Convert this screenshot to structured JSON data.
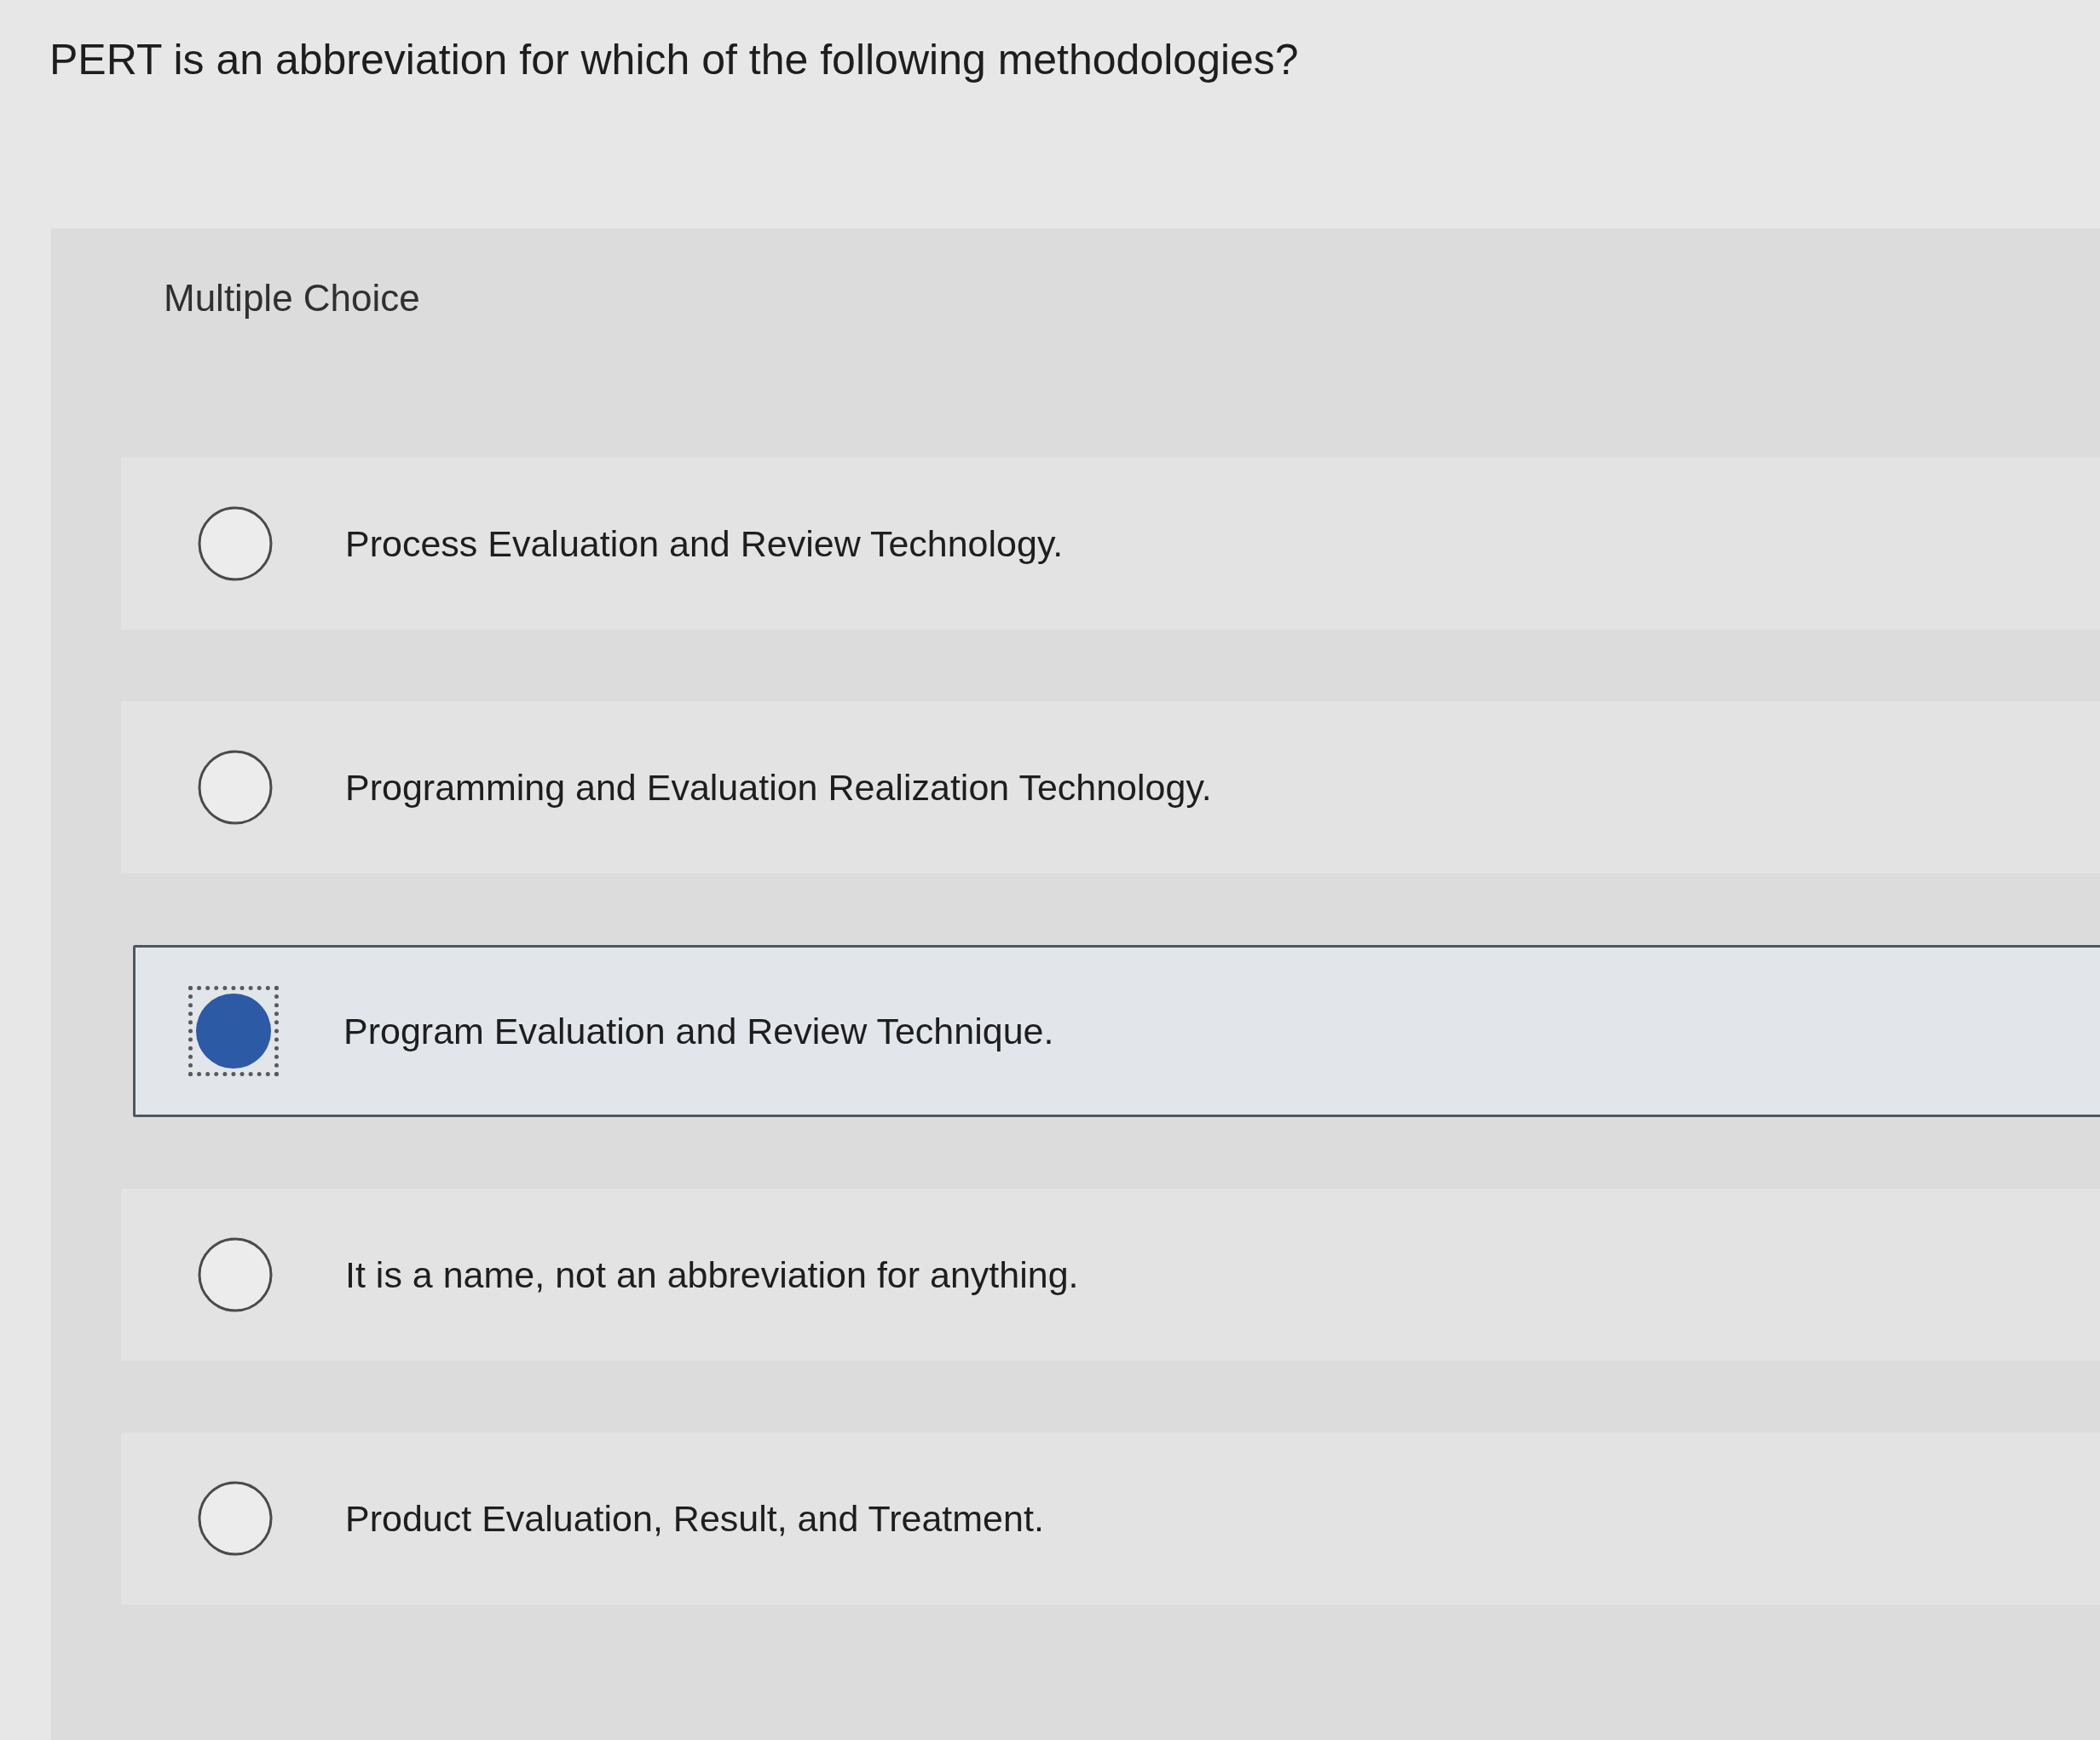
{
  "question": "PERT is an abbreviation for which of the following methodologies?",
  "panel": {
    "title": "Multiple Choice"
  },
  "options": [
    {
      "label": "Process Evaluation and Review Technology.",
      "selected": false
    },
    {
      "label": "Programming and Evaluation Realization Technology.",
      "selected": false
    },
    {
      "label": "Program Evaluation and Review Technique.",
      "selected": true
    },
    {
      "label": "It is a name, not an abbreviation for anything.",
      "selected": false
    },
    {
      "label": "Product Evaluation, Result, and Treatment.",
      "selected": false
    }
  ]
}
